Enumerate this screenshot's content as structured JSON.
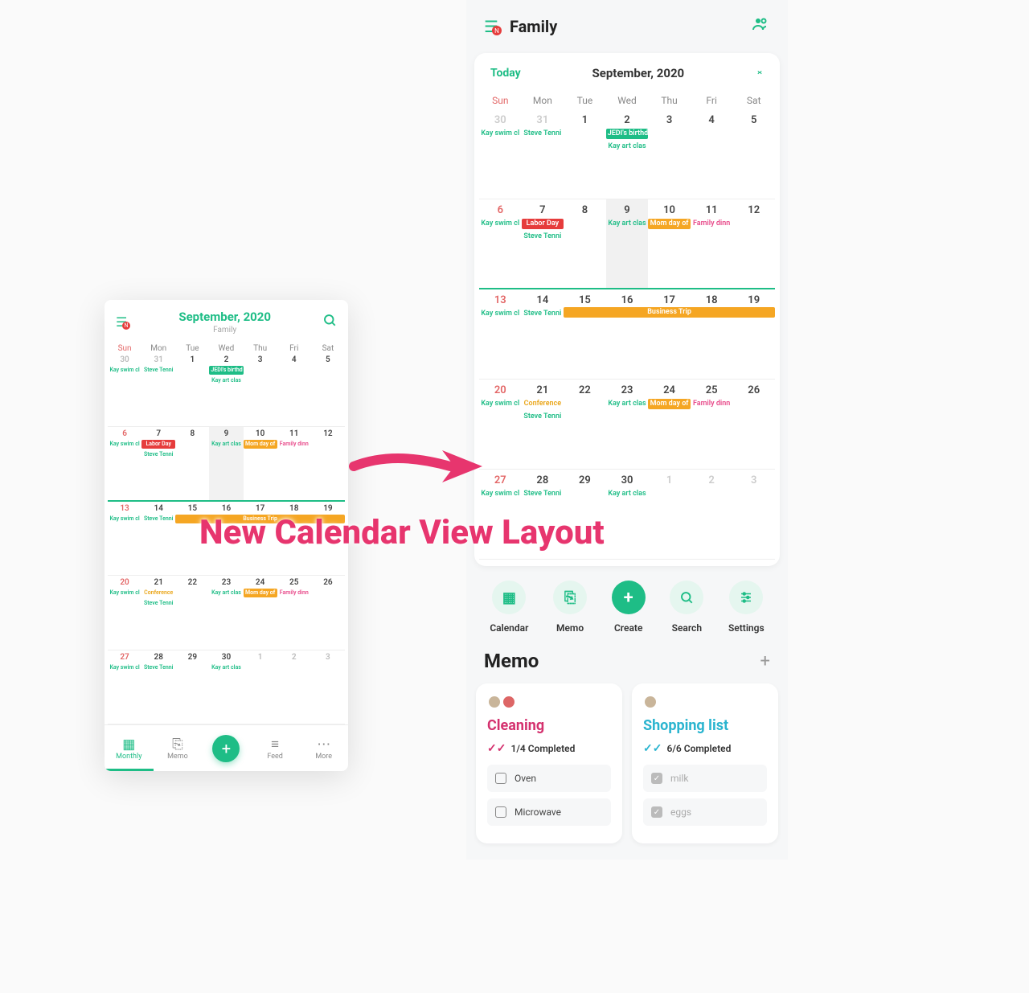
{
  "caption": "New Calendar View Layout",
  "dows": [
    "Sun",
    "Mon",
    "Tue",
    "Wed",
    "Thu",
    "Fri",
    "Sat"
  ],
  "old": {
    "menu_badge": "N",
    "title": "September, 2020",
    "subtitle": "Family",
    "nav": [
      "Monthly",
      "Memo",
      "",
      "Feed",
      "More"
    ]
  },
  "new": {
    "menu_badge": "N",
    "title": "Family",
    "today": "Today",
    "month": "September, 2020",
    "quick": [
      "Calendar",
      "Memo",
      "Create",
      "Search",
      "Settings"
    ],
    "memo_title": "Memo",
    "memo_cards": {
      "cleaning": {
        "title": "Cleaning",
        "progress": "1/4 Completed",
        "items": [
          "Oven",
          "Microwave"
        ]
      },
      "shopping": {
        "title": "Shopping list",
        "progress": "6/6 Completed",
        "items": [
          "milk",
          "eggs"
        ]
      }
    }
  },
  "events": {
    "kay_swim": "Kay swim cl",
    "steve_tenni": "Steve Tenni",
    "jedi_birth": "JEDI's birthd",
    "kay_art": "Kay art clas",
    "labor_day": "Labor Day",
    "mom_day": "Mom day of",
    "family_dinn": "Family dinn",
    "conference": "Conference",
    "business_trip": "Business Trip"
  },
  "weeks": [
    {
      "days": [
        "30",
        "31",
        "1",
        "2",
        "3",
        "4",
        "5"
      ],
      "dimIdx": [
        0,
        1
      ]
    },
    {
      "days": [
        "6",
        "7",
        "8",
        "9",
        "10",
        "11",
        "12"
      ],
      "selected": 3,
      "underline": true
    },
    {
      "days": [
        "13",
        "14",
        "15",
        "16",
        "17",
        "18",
        "19"
      ]
    },
    {
      "days": [
        "20",
        "21",
        "22",
        "23",
        "24",
        "25",
        "26"
      ]
    },
    {
      "days": [
        "27",
        "28",
        "29",
        "30",
        "1",
        "2",
        "3"
      ],
      "dimIdx": [
        4,
        5,
        6
      ]
    }
  ],
  "week_events": [
    [
      [
        "kay_swim:teal"
      ],
      [
        "steve_tenni:teal"
      ],
      [],
      [
        "jedi_birth:bg-teal",
        "kay_art:teal"
      ],
      [],
      [],
      []
    ],
    [
      [
        "kay_swim:teal"
      ],
      [
        "labor_day:bg-red",
        "steve_tenni:teal"
      ],
      [],
      [
        "kay_art:teal"
      ],
      [
        "mom_day:bg-orange"
      ],
      [
        "family_dinn:pink"
      ],
      []
    ],
    [
      [
        "kay_swim:teal"
      ],
      [
        "steve_tenni:teal"
      ],
      [],
      [
        "kay_art:teal"
      ],
      [],
      [],
      []
    ],
    [
      [
        "kay_swim:teal"
      ],
      [
        "conference:orange",
        "steve_tenni:teal"
      ],
      [],
      [
        "kay_art:teal"
      ],
      [
        "mom_day:bg-orange"
      ],
      [
        "family_dinn:pink"
      ],
      []
    ],
    [
      [
        "kay_swim:teal"
      ],
      [
        "steve_tenni:teal"
      ],
      [],
      [
        "kay_art:teal"
      ],
      [],
      [],
      []
    ]
  ],
  "span_event": {
    "row": 2,
    "label": "business_trip",
    "startCol": 2,
    "endCol": 6
  }
}
